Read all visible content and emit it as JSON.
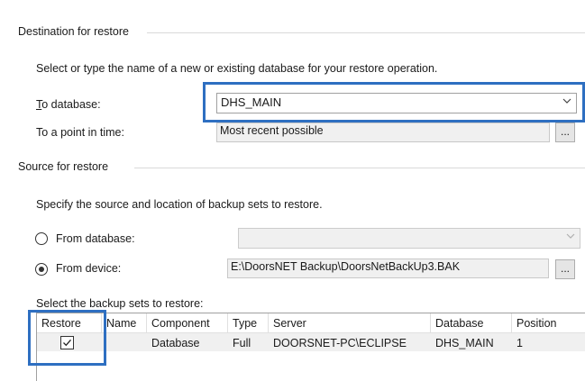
{
  "destination": {
    "group_label": "Destination for restore",
    "instruction": "Select or type the name of a new or existing database for your restore operation.",
    "to_database_label": "To database:",
    "to_database_value": "DHS_MAIN",
    "point_in_time_label": "To a point in time:",
    "point_in_time_value": "Most recent possible",
    "browse_label": "..."
  },
  "source": {
    "group_label": "Source for restore",
    "instruction": "Specify the source and location of backup sets to restore.",
    "from_database_label": "From database:",
    "from_database_value": "",
    "from_device_label": "From device:",
    "from_device_value": "E:\\DoorsNET Backup\\DoorsNetBackUp3.BAK",
    "browse_label": "...",
    "selected_option": "From device"
  },
  "backup_sets": {
    "label": "Select the backup sets to restore:",
    "columns": [
      "Restore",
      "Name",
      "Component",
      "Type",
      "Server",
      "Database",
      "Position"
    ],
    "rows": [
      {
        "restore": true,
        "name": "",
        "component": "Database",
        "type": "Full",
        "server": "DOORSNET-PC\\ECLIPSE",
        "database": "DHS_MAIN",
        "position": "1"
      }
    ]
  },
  "colors": {
    "highlight": "#2e6fc1",
    "disabled_bg": "#f0f0f0"
  }
}
